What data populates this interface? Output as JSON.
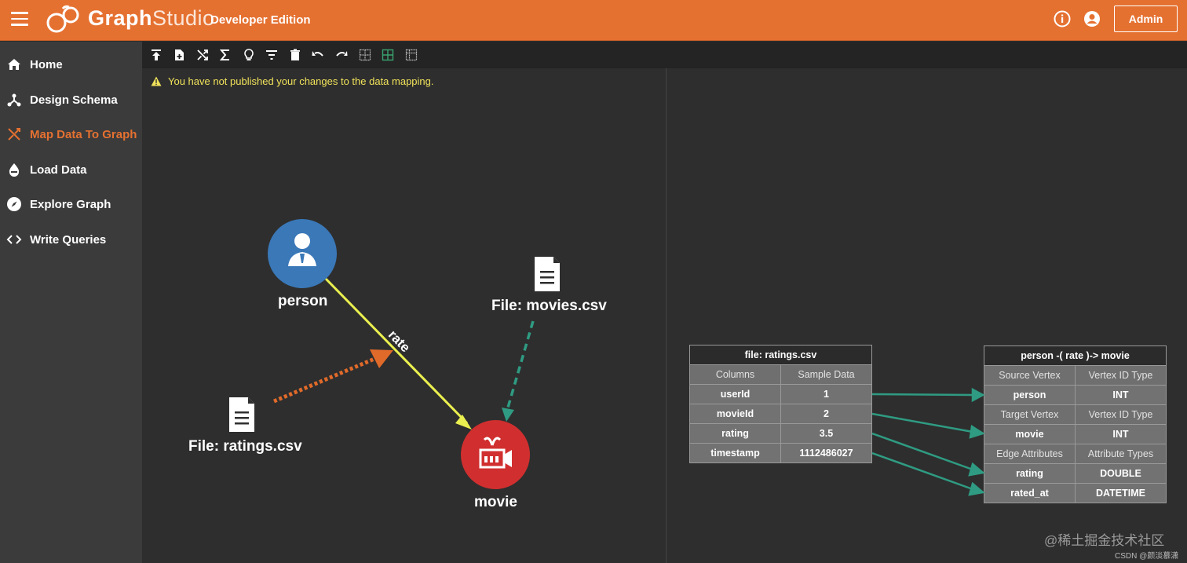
{
  "header": {
    "brand_prefix": "Graph",
    "brand_suffix": "Studio",
    "edition": "Developer Edition",
    "admin_label": "Admin",
    "icons": [
      "menu-icon",
      "graphstudio-logo-icon",
      "info-icon",
      "user-account-icon"
    ]
  },
  "sidebar": {
    "items": [
      {
        "label": "Home",
        "icon": "home-icon",
        "active": false
      },
      {
        "label": "Design Schema",
        "icon": "schema-icon",
        "active": false
      },
      {
        "label": "Map Data To Graph",
        "icon": "map-data-icon",
        "active": true
      },
      {
        "label": "Load Data",
        "icon": "load-data-icon",
        "active": false
      },
      {
        "label": "Explore Graph",
        "icon": "compass-icon",
        "active": false
      },
      {
        "label": "Write Queries",
        "icon": "code-icon",
        "active": false
      }
    ]
  },
  "toolbar": {
    "icons": [
      "publish-icon",
      "add-file-icon",
      "map-icon",
      "sum-icon",
      "token-function-icon",
      "filter-icon",
      "delete-icon",
      "undo-icon",
      "redo-icon",
      "table-icon",
      "table-green-icon",
      "table-alt-icon"
    ]
  },
  "warning": {
    "text": "You have not published your changes to the data mapping."
  },
  "graph": {
    "nodes": {
      "person": "person",
      "movie": "movie",
      "movies_file": "File: movies.csv",
      "ratings_file": "File: ratings.csv"
    },
    "edge_label": "rate"
  },
  "source_table": {
    "title": "file: ratings.csv",
    "headers": [
      "Columns",
      "Sample Data"
    ],
    "rows": [
      [
        "userId",
        "1"
      ],
      [
        "movieId",
        "2"
      ],
      [
        "rating",
        "3.5"
      ],
      [
        "timestamp",
        "1112486027"
      ]
    ]
  },
  "target_table": {
    "title": "person -( rate )-> movie",
    "source_header": [
      "Source Vertex",
      "Vertex ID Type"
    ],
    "source_row": [
      "person",
      "INT"
    ],
    "target_header": [
      "Target Vertex",
      "Vertex ID Type"
    ],
    "target_row": [
      "movie",
      "INT"
    ],
    "attr_header": [
      "Edge Attributes",
      "Attribute Types"
    ],
    "attr_rows": [
      [
        "rating",
        "DOUBLE"
      ],
      [
        "rated_at",
        "DATETIME"
      ]
    ]
  },
  "colors": {
    "accent": "#e57131",
    "person_node": "#3a78b8",
    "movie_node": "#d12f2f",
    "edge_yellow": "#eaf04f",
    "dashed_teal": "#2f9b82",
    "dashed_orange": "#e06a2a"
  },
  "watermark": "@稀土掘金技术社区",
  "watermark_small": "CSDN @颜淡慕潇"
}
